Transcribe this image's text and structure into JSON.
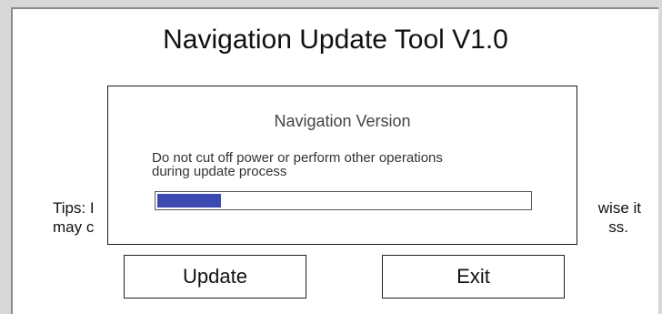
{
  "app": {
    "title": "Navigation Update Tool V1.0"
  },
  "tips": {
    "line1_start": "Tips: I",
    "line1_end": "wise it",
    "line2_start": "may c",
    "line2_end": "ss."
  },
  "buttons": {
    "update_label": "Update",
    "exit_label": "Exit"
  },
  "dialog": {
    "title": "Navigation Version",
    "message_line1": "Do not cut off power or perform other operations",
    "message_line2": "during update process",
    "progress_fraction": 0.17
  },
  "colors": {
    "progress_fill": "#3c49b0",
    "background": "#d8d8d8",
    "window": "#ffffff"
  }
}
